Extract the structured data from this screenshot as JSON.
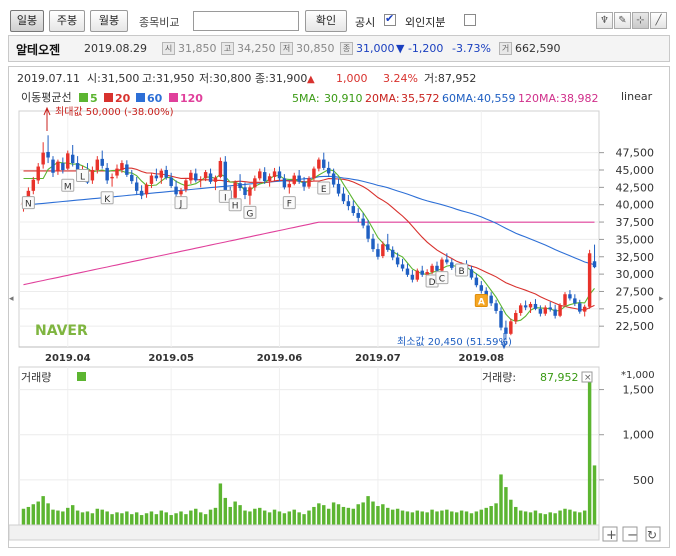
{
  "toolbar": {
    "period_tabs": [
      {
        "label": "일봉",
        "active": true
      },
      {
        "label": "주봉",
        "active": false
      },
      {
        "label": "월봉",
        "active": false
      }
    ],
    "compare_label": "종목비교",
    "compare_value": "",
    "confirm_label": "확인",
    "disclosure_label": "공시",
    "disclosure_checked": true,
    "foreign_label": "외인지분",
    "foreign_checked": false
  },
  "infobar": {
    "name": "알테오젠",
    "date": "2019.08.29",
    "open": "31,850",
    "high": "34,250",
    "low": "30,850",
    "close": "31,000",
    "change": "▼ -1,200",
    "change_pct": "-3.73%",
    "volume": "662,590",
    "icon_open": "시",
    "icon_high": "고",
    "icon_low": "저",
    "icon_close": "종",
    "icon_volume": "거"
  },
  "header": {
    "date": "2019.07.11",
    "open_text": "시:31,500",
    "high_text": "고:31,950",
    "low_text": "저:30,800",
    "close_text": "종:31,900",
    "change_arrow": "▲",
    "change": "1,000",
    "change_pct": "3.24%",
    "volume_text": "거:87,952"
  },
  "legend": {
    "title": "이동평균선",
    "items": [
      {
        "label": "5",
        "color": "#5cb531"
      },
      {
        "label": "20",
        "color": "#d8322e"
      },
      {
        "label": "60",
        "color": "#2d6fd6"
      },
      {
        "label": "120",
        "color": "#e0409b"
      }
    ],
    "ma_values": [
      {
        "label": "5MA:",
        "value": "30,910",
        "color": "#3a9a14"
      },
      {
        "label": "20MA:",
        "value": "35,572",
        "color": "#c8221e"
      },
      {
        "label": "60MA:",
        "value": "40,559",
        "color": "#1f5fc2"
      },
      {
        "label": "120MA:",
        "value": "38,982",
        "color": "#d02f8a"
      }
    ],
    "scale_label": "linear"
  },
  "brand": "NAVER",
  "volume_label": "거래량",
  "volume_value_label": "거래량:",
  "volume_value": "87,952",
  "volume_unit": "*1,000",
  "chart_data": {
    "type": "candlestick",
    "y_ticks": [
      22500,
      25000,
      27500,
      30000,
      32500,
      35000,
      37500,
      40000,
      42500,
      45000,
      47500
    ],
    "y_tick_labels": [
      "22,500",
      "25,000",
      "27,500",
      "30,000",
      "32,500",
      "35,000",
      "37,500",
      "40,000",
      "42,500",
      "45,000",
      "47,500"
    ],
    "ylim": [
      19500,
      53500
    ],
    "x_labels": [
      "2019.04",
      "2019.05",
      "2019.06",
      "2019.07",
      "2019.08"
    ],
    "x_label_indices": [
      9,
      30,
      52,
      72,
      93
    ],
    "n_candles": 115,
    "max_annotation": {
      "text": "최대값 50,000 (-38.00%)",
      "index": 5,
      "value": 50000
    },
    "min_annotation": {
      "text": "최소값 20,450 (51.59%)",
      "index": 98,
      "value": 20450
    },
    "markers": [
      {
        "label": "N",
        "index": 1,
        "value": 40300
      },
      {
        "label": "M",
        "index": 9,
        "value": 42800
      },
      {
        "label": "L",
        "index": 12,
        "value": 44200
      },
      {
        "label": "K",
        "index": 17,
        "value": 41000
      },
      {
        "label": "J",
        "index": 32,
        "value": 40300
      },
      {
        "label": "I",
        "index": 41,
        "value": 41200
      },
      {
        "label": "H",
        "index": 43,
        "value": 40000
      },
      {
        "label": "G",
        "index": 46,
        "value": 38900
      },
      {
        "label": "F",
        "index": 54,
        "value": 40300
      },
      {
        "label": "E",
        "index": 61,
        "value": 42400
      },
      {
        "label": "D",
        "index": 83,
        "value": 29000
      },
      {
        "label": "C",
        "index": 85,
        "value": 29500
      },
      {
        "label": "B",
        "index": 89,
        "value": 30600
      },
      {
        "label": "A",
        "index": 93,
        "value": 26200,
        "highlight": true
      }
    ],
    "ohlc": [
      [
        40000,
        40800,
        39000,
        40300
      ],
      [
        40400,
        42500,
        40000,
        42000
      ],
      [
        42000,
        44000,
        41500,
        43600
      ],
      [
        43500,
        46000,
        43000,
        45500
      ],
      [
        45800,
        49000,
        45200,
        47500
      ],
      [
        47600,
        50000,
        46000,
        46800
      ],
      [
        46500,
        47000,
        44000,
        44600
      ],
      [
        44800,
        46500,
        44300,
        46200
      ],
      [
        46000,
        46800,
        44500,
        45000
      ],
      [
        45200,
        47800,
        45000,
        47400
      ],
      [
        47200,
        48600,
        45500,
        46000
      ],
      [
        46000,
        47000,
        44200,
        44800
      ],
      [
        44500,
        45600,
        43600,
        44800
      ],
      [
        44500,
        46000,
        43000,
        43200
      ],
      [
        43500,
        45500,
        43000,
        45000
      ],
      [
        45000,
        47000,
        44500,
        46500
      ],
      [
        46600,
        47800,
        45200,
        45600
      ],
      [
        45300,
        46000,
        43000,
        43500
      ],
      [
        43800,
        44500,
        42600,
        44000
      ],
      [
        44200,
        45800,
        43800,
        45200
      ],
      [
        45000,
        46400,
        44600,
        46000
      ],
      [
        45800,
        46400,
        44000,
        44300
      ],
      [
        44300,
        45000,
        43000,
        43400
      ],
      [
        43200,
        44000,
        41500,
        42000
      ],
      [
        42000,
        42800,
        40800,
        41300
      ],
      [
        41500,
        43200,
        41000,
        42900
      ],
      [
        43000,
        44600,
        42400,
        44200
      ],
      [
        44200,
        45200,
        43400,
        43800
      ],
      [
        43900,
        45200,
        43000,
        44900
      ],
      [
        45000,
        45600,
        43600,
        43900
      ],
      [
        43900,
        44600,
        42400,
        42700
      ],
      [
        42600,
        43500,
        41200,
        41500
      ],
      [
        41500,
        42400,
        40600,
        42000
      ],
      [
        42200,
        43800,
        41800,
        43500
      ],
      [
        43500,
        45000,
        43000,
        44600
      ],
      [
        44500,
        45200,
        43200,
        43500
      ],
      [
        43500,
        44100,
        42500,
        43700
      ],
      [
        43800,
        45000,
        43400,
        44700
      ],
      [
        44500,
        45200,
        43000,
        43300
      ],
      [
        43300,
        44200,
        42100,
        43900
      ],
      [
        44000,
        46800,
        43800,
        46300
      ],
      [
        46200,
        47000,
        41500,
        42000
      ],
      [
        42000,
        42600,
        40200,
        40800
      ],
      [
        41000,
        43500,
        40500,
        43200
      ],
      [
        43100,
        44400,
        42000,
        42400
      ],
      [
        42500,
        43200,
        40800,
        41400
      ],
      [
        41300,
        42800,
        40000,
        42500
      ],
      [
        42500,
        44200,
        42000,
        43800
      ],
      [
        43800,
        45200,
        43500,
        44800
      ],
      [
        44700,
        45400,
        43000,
        43400
      ],
      [
        43400,
        44500,
        42600,
        44100
      ],
      [
        44000,
        45300,
        43400,
        44800
      ],
      [
        44800,
        45500,
        43400,
        43800
      ],
      [
        43800,
        44400,
        42200,
        42500
      ],
      [
        42500,
        43500,
        41600,
        43000
      ],
      [
        43000,
        44600,
        42800,
        44200
      ],
      [
        44200,
        45000,
        43000,
        43300
      ],
      [
        43300,
        44000,
        42000,
        42600
      ],
      [
        42600,
        44100,
        42300,
        43800
      ],
      [
        43800,
        45500,
        43500,
        45200
      ],
      [
        45200,
        46800,
        44800,
        46500
      ],
      [
        46500,
        47500,
        45000,
        45300
      ],
      [
        45300,
        46200,
        44000,
        44500
      ],
      [
        44500,
        45200,
        42500,
        42900
      ],
      [
        43000,
        43800,
        41200,
        41600
      ],
      [
        41600,
        42500,
        40100,
        40500
      ],
      [
        40500,
        41400,
        39200,
        39800
      ],
      [
        39800,
        40600,
        38400,
        38800
      ],
      [
        38800,
        39500,
        37500,
        38100
      ],
      [
        38000,
        38800,
        36600,
        37000
      ],
      [
        37000,
        37800,
        34600,
        35100
      ],
      [
        35100,
        35800,
        33200,
        33600
      ],
      [
        33600,
        34400,
        32100,
        32500
      ],
      [
        32600,
        34700,
        32300,
        34300
      ],
      [
        34300,
        35800,
        33200,
        33500
      ],
      [
        33500,
        34000,
        32000,
        32400
      ],
      [
        32400,
        33100,
        31000,
        31400
      ],
      [
        31400,
        32200,
        30400,
        30800
      ],
      [
        30800,
        31500,
        29600,
        29900
      ],
      [
        29900,
        30600,
        28800,
        29200
      ],
      [
        29200,
        30800,
        28900,
        30500
      ],
      [
        30500,
        31200,
        29600,
        29900
      ],
      [
        29900,
        30700,
        29100,
        30300
      ],
      [
        30300,
        31500,
        30000,
        31200
      ],
      [
        31200,
        31800,
        30200,
        30500
      ],
      [
        30500,
        32400,
        30300,
        32100
      ],
      [
        32100,
        33000,
        31400,
        31700
      ],
      [
        31700,
        32200,
        30600,
        30900
      ],
      [
        30900,
        31400,
        29800,
        30200
      ],
      [
        30200,
        31700,
        30000,
        31400
      ],
      [
        31400,
        32000,
        30400,
        30700
      ],
      [
        30700,
        31200,
        29200,
        29500
      ],
      [
        29500,
        30100,
        28100,
        28400
      ],
      [
        28400,
        29000,
        27200,
        27600
      ],
      [
        27600,
        28100,
        26400,
        26900
      ],
      [
        26900,
        27400,
        25400,
        25800
      ],
      [
        25800,
        26300,
        24300,
        24700
      ],
      [
        24700,
        25200,
        21900,
        22300
      ],
      [
        22300,
        23300,
        20450,
        21400
      ],
      [
        21400,
        23600,
        21200,
        23200
      ],
      [
        23200,
        24800,
        22800,
        24400
      ],
      [
        24400,
        25800,
        24000,
        25500
      ],
      [
        25500,
        26200,
        24800,
        25200
      ],
      [
        25200,
        26000,
        24400,
        25700
      ],
      [
        25700,
        26400,
        24800,
        25000
      ],
      [
        25000,
        25500,
        23900,
        24300
      ],
      [
        24300,
        25500,
        24000,
        25200
      ],
      [
        25200,
        26000,
        24600,
        24900
      ],
      [
        24900,
        25600,
        23600,
        24000
      ],
      [
        24000,
        25800,
        23800,
        25500
      ],
      [
        25500,
        27400,
        25300,
        27100
      ],
      [
        27100,
        27700,
        26200,
        26500
      ],
      [
        26500,
        27100,
        25400,
        25800
      ],
      [
        25800,
        26300,
        24300,
        24600
      ],
      [
        24600,
        25600,
        23900,
        25300
      ],
      [
        25300,
        33500,
        25000,
        33000
      ],
      [
        31850,
        34250,
        30850,
        31000
      ]
    ],
    "volume_ticks": [
      500,
      1000,
      1500
    ],
    "volume_tick_labels": [
      "500",
      "1,000",
      "1,500"
    ],
    "volume_ylim": [
      0,
      1750
    ],
    "volume": [
      180,
      200,
      230,
      260,
      320,
      240,
      170,
      160,
      150,
      190,
      220,
      160,
      140,
      150,
      130,
      180,
      170,
      150,
      120,
      140,
      130,
      150,
      120,
      140,
      110,
      130,
      150,
      120,
      160,
      140,
      110,
      130,
      150,
      120,
      160,
      180,
      140,
      120,
      170,
      190,
      460,
      300,
      200,
      260,
      220,
      160,
      150,
      180,
      190,
      160,
      140,
      170,
      150,
      130,
      150,
      170,
      140,
      120,
      160,
      200,
      240,
      220,
      180,
      250,
      230,
      200,
      190,
      180,
      230,
      250,
      320,
      260,
      210,
      230,
      190,
      170,
      180,
      160,
      150,
      140,
      160,
      150,
      140,
      170,
      150,
      160,
      170,
      150,
      140,
      160,
      150,
      130,
      150,
      170,
      190,
      210,
      240,
      560,
      420,
      280,
      200,
      160,
      150,
      140,
      160,
      130,
      120,
      140,
      130,
      160,
      180,
      170,
      150,
      140,
      160,
      1640,
      660
    ]
  }
}
